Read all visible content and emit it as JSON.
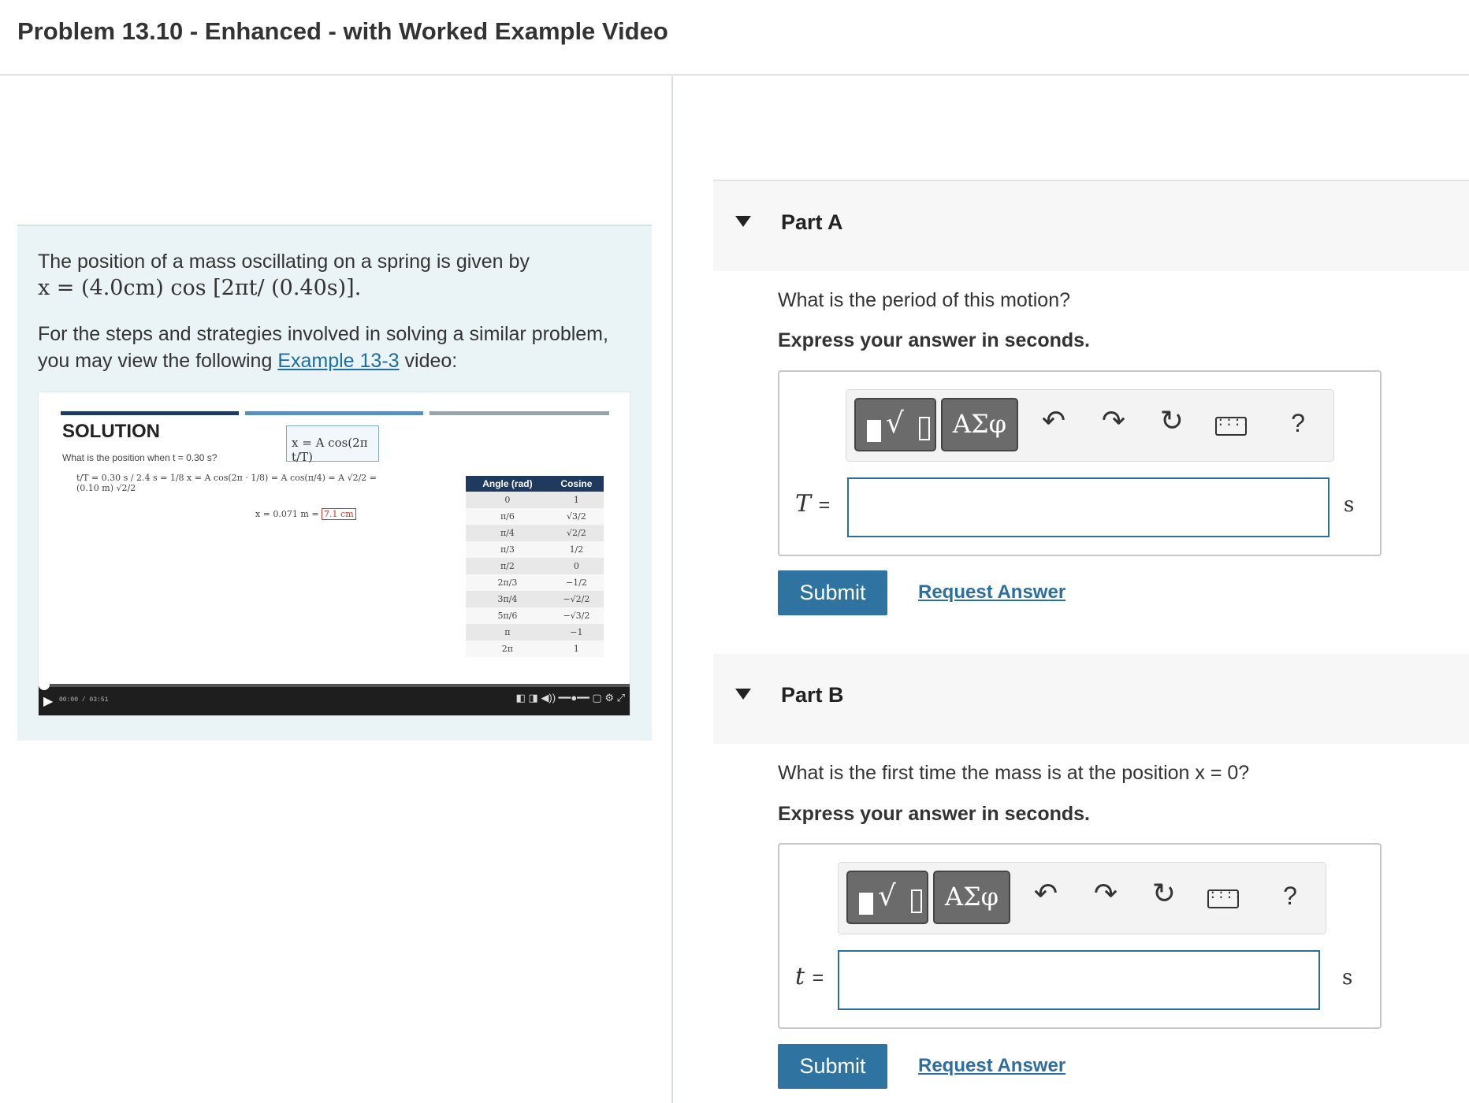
{
  "header": {
    "title": "Problem 13.10 - Enhanced - with Worked Example Video"
  },
  "intro": {
    "p1_text": "The position of a mass oscillating on a spring is given by",
    "p1_math": "x = (4.0cm) cos [2πt/ (0.40s)].",
    "p2_prefix": "For the steps and strategies involved in solving a similar problem, you may view the following ",
    "p2_link": "Example 13-3",
    "p2_suffix": " video:"
  },
  "video": {
    "solution_label": "SOLUTION",
    "formula": "x = A cos(2π t/T)",
    "question": "What is the position when t = 0.30 s?",
    "work1": "t/T = 0.30 s / 2.4 s = 1/8    x = A cos(2π · 1/8) = A cos(π/4) = A √2/2 = (0.10 m) √2/2",
    "work2_prefix": "x = 0.071 m = ",
    "work2_box": "7.1 cm",
    "table_header": [
      "Angle (rad)",
      "Cosine"
    ],
    "table_rows": [
      [
        "0",
        "1"
      ],
      [
        "π/6",
        "√3/2"
      ],
      [
        "π/4",
        "√2/2"
      ],
      [
        "π/3",
        "1/2"
      ],
      [
        "π/2",
        "0"
      ],
      [
        "2π/3",
        "−1/2"
      ],
      [
        "3π/4",
        "−√2/2"
      ],
      [
        "5π/6",
        "−√3/2"
      ],
      [
        "π",
        "−1"
      ],
      [
        "2π",
        "1"
      ]
    ],
    "time": "00:00 / 03:51",
    "play_icon": "play-icon"
  },
  "toolbar": {
    "greek_label": "ΑΣφ",
    "undo_icon": "↶",
    "redo_icon": "↷",
    "reset_icon": "↻",
    "keyboard_icon": "⌨",
    "help_label": "?"
  },
  "partA": {
    "title": "Part A",
    "question": "What is the period of this motion?",
    "instruction": "Express your answer in seconds.",
    "var": "T",
    "eq": "=",
    "value": "",
    "unit": "s",
    "submit_label": "Submit",
    "request_label": "Request Answer"
  },
  "partB": {
    "title": "Part B",
    "question": "What is the first time the mass is at the position x = 0?",
    "instruction": "Express your answer in seconds.",
    "var": "t",
    "eq": "=",
    "value": "",
    "unit": "s",
    "submit_label": "Submit",
    "request_label": "Request Answer"
  },
  "colors": {
    "accent": "#2f73a0",
    "intro_bg": "#eaf4f6",
    "part_bg": "#f7f7f7"
  }
}
